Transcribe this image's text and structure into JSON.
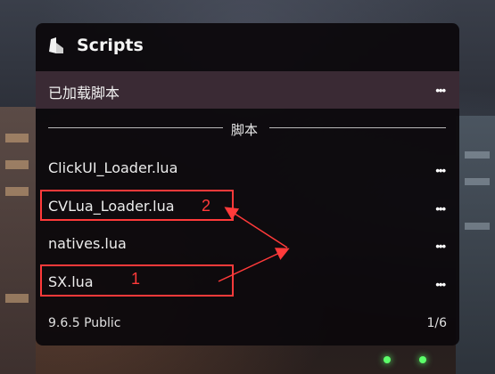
{
  "window": {
    "title": "Scripts",
    "logo_icon": "stone-logo-icon"
  },
  "tab": {
    "label": "已加载脚本",
    "menu_icon": "more-dots-icon"
  },
  "section": {
    "label": "脚本"
  },
  "scripts": [
    {
      "name": "ClickUI_Loader.lua"
    },
    {
      "name": "CVLua_Loader.lua"
    },
    {
      "name": "natives.lua"
    },
    {
      "name": "SX.lua"
    }
  ],
  "footer": {
    "version": "9.6.5 Public",
    "page": "1/6"
  },
  "annotations": {
    "labels": [
      "2",
      "1"
    ],
    "color": "#ff3a3a"
  },
  "colors": {
    "panel_bg": "#0c090c",
    "tab_bg": "#3a2a34",
    "accent_red": "#ff3a3a"
  }
}
